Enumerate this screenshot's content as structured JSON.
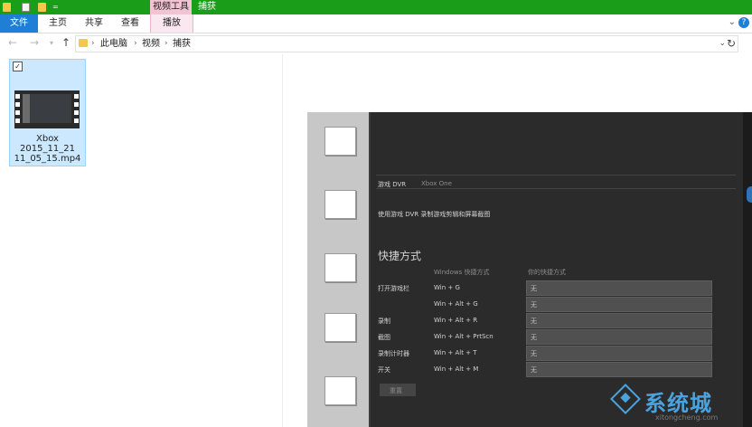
{
  "window": {
    "context_tab_label": "视频工具",
    "title": "捕获"
  },
  "ribbon": {
    "tabs": [
      "文件",
      "主页",
      "共享",
      "查看",
      "播放"
    ]
  },
  "address_bar": {
    "breadcrumbs": [
      "此电脑",
      "视频",
      "捕获"
    ]
  },
  "files": [
    {
      "name_lines": [
        "Xbox",
        "2015_11_21",
        "11_05_15.mp4"
      ],
      "selected": true
    }
  ],
  "preview": {
    "tabs": [
      "游戏 DVR",
      "Xbox One"
    ],
    "description": "使用游戏 DVR 录制游戏剪辑和屏幕截图",
    "section_title": "快捷方式",
    "headers": [
      "Windows 快捷方式",
      "你的快捷方式"
    ],
    "rows": [
      {
        "label": "打开游戏栏",
        "windows": "Win + G",
        "custom": "无"
      },
      {
        "label": "",
        "windows": "Win + Alt + G",
        "custom": "无"
      },
      {
        "label": "录制",
        "windows": "Win + Alt + R",
        "custom": "无"
      },
      {
        "label": "截图",
        "windows": "Win + Alt + PrtScn",
        "custom": "无"
      },
      {
        "label": "录制计时器",
        "windows": "Win + Alt + T",
        "custom": "无"
      },
      {
        "label": "开关",
        "windows": "Win + Alt + M",
        "custom": "无"
      }
    ],
    "reset_label": "重置"
  },
  "watermark": {
    "brand": "系统城",
    "url": "xitongcheng.com"
  },
  "colors": {
    "title_bar": "#1a9e1a",
    "file_tab": "#1f7fd6",
    "context_tab": "#f2c3d3",
    "selection": "#cce8ff",
    "watermark": "#4aa3df"
  }
}
